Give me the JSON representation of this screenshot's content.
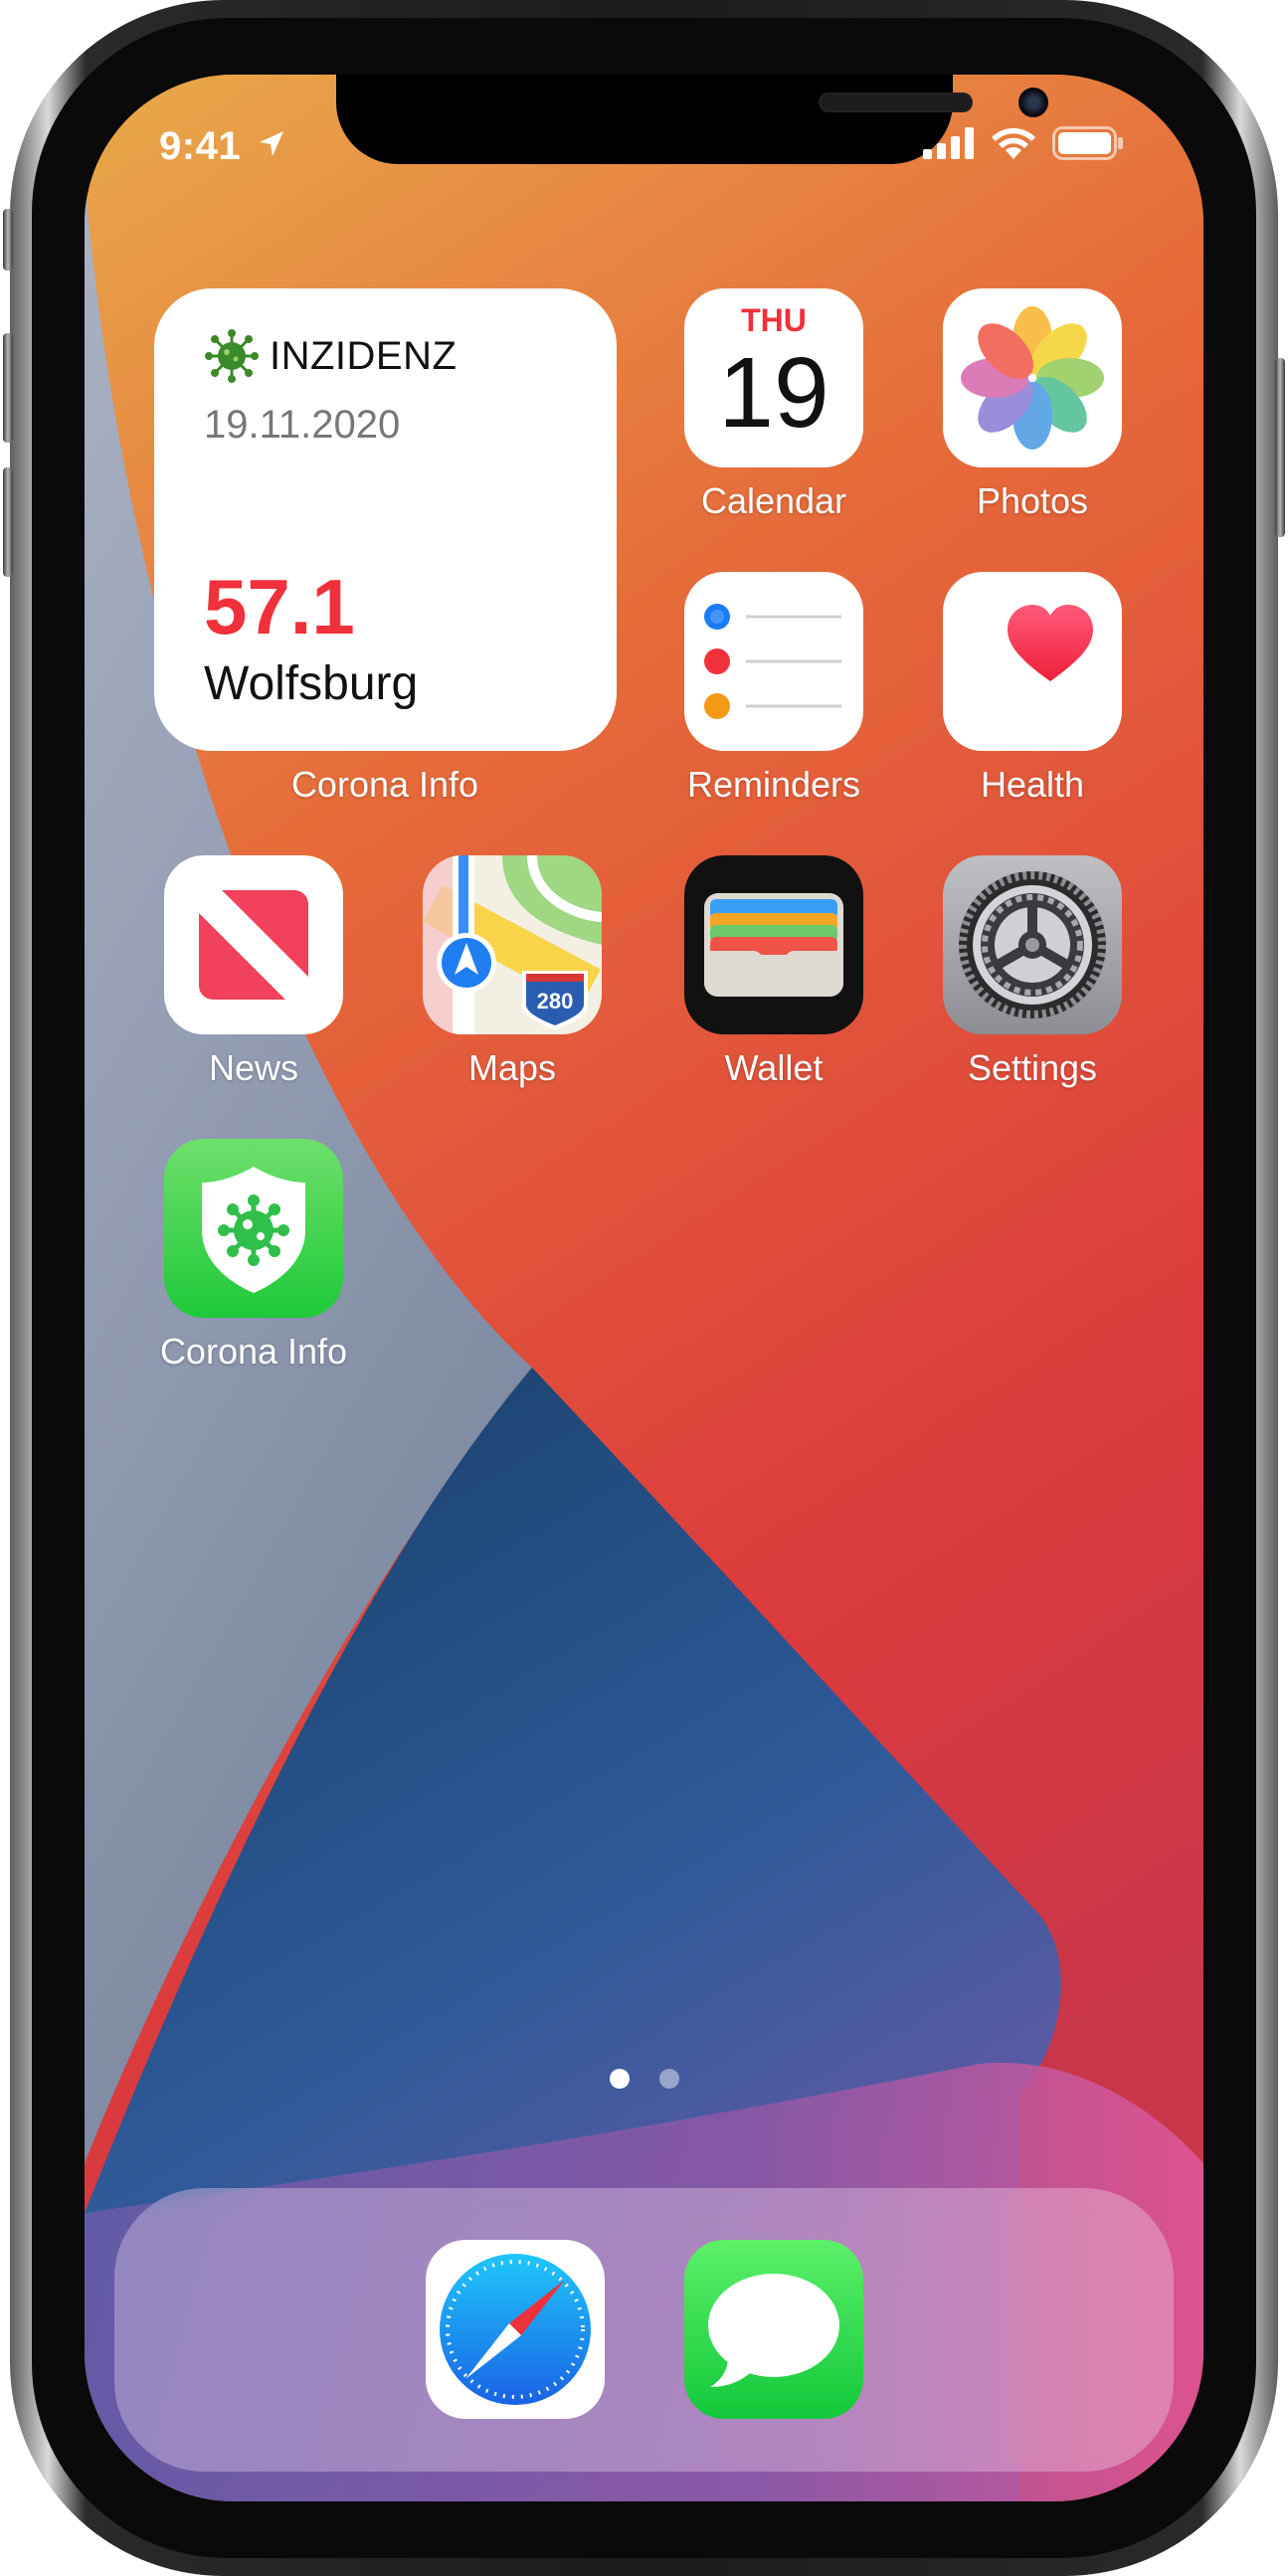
{
  "status_bar": {
    "time": "9:41"
  },
  "widget": {
    "title": "INZIDENZ",
    "date": "19.11.2020",
    "value": "57.1",
    "city": "Wolfsburg",
    "app_label": "Corona Info"
  },
  "apps": {
    "calendar": {
      "label": "Calendar",
      "weekday": "THU",
      "day": "19"
    },
    "photos": {
      "label": "Photos"
    },
    "reminders": {
      "label": "Reminders"
    },
    "health": {
      "label": "Health"
    },
    "news": {
      "label": "News"
    },
    "maps": {
      "label": "Maps",
      "shield_number": "280"
    },
    "wallet": {
      "label": "Wallet"
    },
    "settings": {
      "label": "Settings"
    },
    "corona_info": {
      "label": "Corona Info"
    }
  },
  "page_indicator": {
    "pages": 2,
    "current": 1
  },
  "dock": [
    "Safari",
    "Messages"
  ]
}
